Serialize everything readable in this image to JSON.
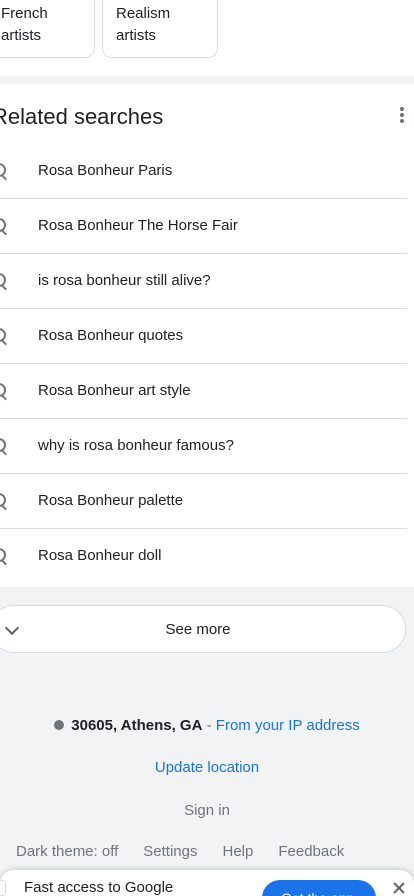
{
  "chips": [
    {
      "line1": "French",
      "line2": "artists"
    },
    {
      "line1": "Realism",
      "line2": "artists"
    }
  ],
  "related": {
    "title": "Related searches",
    "items": [
      "Rosa Bonheur Paris",
      "Rosa Bonheur The Horse Fair",
      "is rosa bonheur still alive?",
      "Rosa Bonheur quotes",
      "Rosa Bonheur art style",
      "why is rosa bonheur famous?",
      "Rosa Bonheur palette",
      "Rosa Bonheur doll"
    ],
    "see_more": "See more"
  },
  "location": {
    "place": "30605, Athens, GA",
    "separator": " - ",
    "source": "From your IP address",
    "update": "Update location"
  },
  "footer": {
    "sign_in": "Sign in",
    "links": [
      "Dark theme: off",
      "Settings",
      "Help",
      "Feedback"
    ]
  },
  "promo": {
    "text": "Fast access to Google",
    "button": "Get the app"
  },
  "colors": {
    "link": "#1a73e8",
    "muted": "#70757a",
    "page_bg": "#f1f3f4",
    "button_bg": "#1a73e8"
  },
  "icons": [
    "more-vert-icon",
    "search-icon",
    "chevron-down-icon",
    "location-dot-icon",
    "close-icon"
  ]
}
